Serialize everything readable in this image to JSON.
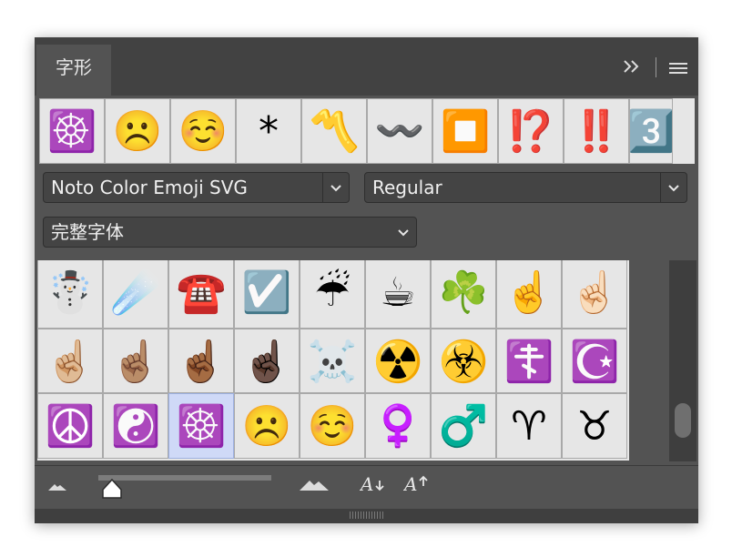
{
  "panel": {
    "tab_label": "字形"
  },
  "recent_glyphs": [
    "☸️",
    "☹️",
    "☺️",
    "*",
    "〽️",
    "〰️",
    "⏹️",
    "⁉️",
    "‼️",
    "3️⃣"
  ],
  "font_family": {
    "value": "Noto Color Emoji SVG"
  },
  "font_style": {
    "value": "Regular"
  },
  "glyph_filter": {
    "value": "完整字体"
  },
  "glyph_grid": {
    "rows": [
      [
        "☃️",
        "☄️",
        "☎️",
        "☑️",
        "☔",
        "☕",
        "☘️",
        "☝️",
        "☝🏻"
      ],
      [
        "☝🏼",
        "☝🏽",
        "☝🏾",
        "☝🏿",
        "☠️",
        "☢️",
        "☣️",
        "☦️",
        "☪️"
      ],
      [
        "☮️",
        "☯️",
        "☸️",
        "☹️",
        "☺️",
        "♀️",
        "♂️",
        "♈",
        "♉"
      ]
    ],
    "selected": "☸️"
  },
  "icons": {
    "expand": "double-chevron-right-icon",
    "menu": "hamburger-menu-icon",
    "dropdown": "chevron-down-icon",
    "small_size": "mountain-small-icon",
    "large_size": "mountain-large-icon",
    "decrease_font": "font-size-decrease-icon",
    "increase_font": "font-size-increase-icon"
  },
  "colors": {
    "panel_bg": "#535353",
    "tab_strip": "#424242",
    "cell_bg": "#e6e6e6",
    "selected_cell": "#cfd9f7",
    "text": "#f0f0f0"
  },
  "glyph_size_fraction": 0.05
}
